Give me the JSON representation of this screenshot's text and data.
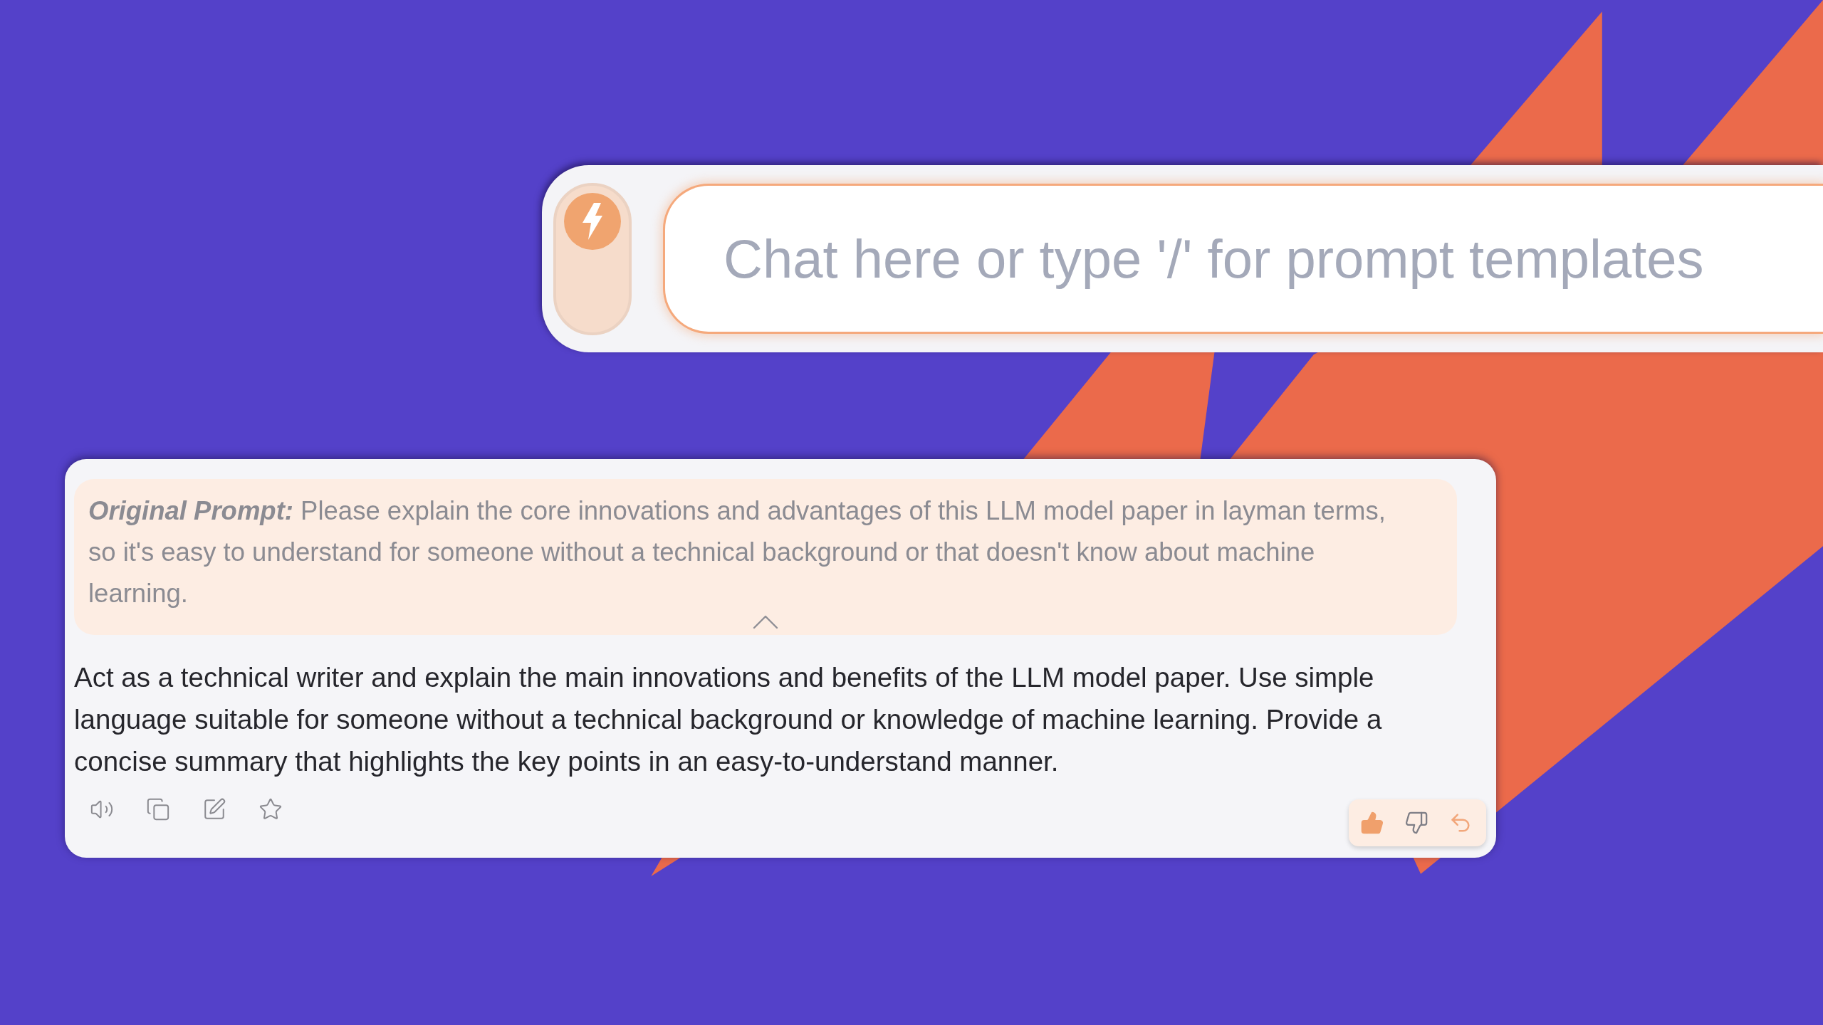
{
  "chat_bar": {
    "toggle": {
      "on": true
    },
    "input": {
      "placeholder": "Chat here or type '/' for prompt templates"
    }
  },
  "message": {
    "original_prompt": {
      "text": "**Original Prompt:** Please explain the core innovations and advantages of this LLM model paper in layman terms, so it's easy to understand for someone without a technical background or that doesn't know about machine learning.",
      "expanded": true
    },
    "response": "Act as a technical writer and explain the main innovations and benefits of the LLM model paper. Use simple language suitable for someone without a technical background or knowledge of machine learning. Provide a concise summary that highlights the key points in an easy-to-understand manner.",
    "feedback": {
      "liked": true,
      "disliked": false
    }
  }
}
